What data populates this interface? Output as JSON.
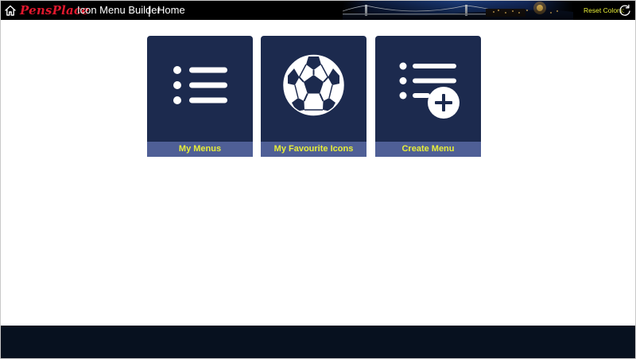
{
  "header": {
    "logo_text": "PensPlace",
    "app_title": "Icon Menu Builder",
    "separator": "|",
    "page_title": "Home",
    "reset_label": "Reset Colors:",
    "home_icon": "home-icon",
    "reset_icon": "refresh-icon"
  },
  "tiles": [
    {
      "label": "My Menus",
      "icon": "list-icon"
    },
    {
      "label": "My Favourite Icons",
      "icon": "soccer-ball-icon"
    },
    {
      "label": "Create Menu",
      "icon": "add-list-icon"
    }
  ],
  "colors": {
    "header_bg": "#000000",
    "tile_bg": "#1c2a4e",
    "tile_label_bg": "#4f5f96",
    "label_text": "#e8ee38",
    "logo": "#e0182d",
    "footer_bg": "#07111f"
  }
}
